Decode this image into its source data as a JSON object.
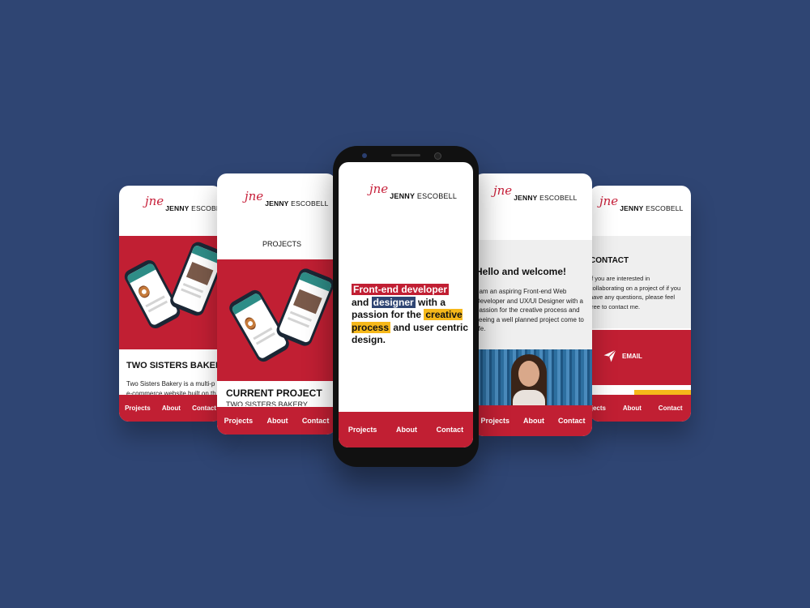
{
  "brand": {
    "signature": "jne",
    "first": "JENNY",
    "last": "ESCOBELL"
  },
  "nav": {
    "projects": "Projects",
    "about": "About",
    "contact": "Contact"
  },
  "card_far_left": {
    "title": "TWO SISTERS BAKERY",
    "body": "Two Sisters Bakery is a multi-p e-commerce website built on th"
  },
  "card_left": {
    "section_label": "PROJECTS",
    "title": "CURRENT PROJECT",
    "subtitle": "TWO SISTERS BAKERY"
  },
  "card_center": {
    "hero": {
      "part1": "Front-end developer",
      "part2": "and ",
      "part3": "designer",
      "part4": " with a passion for the ",
      "part5": "creative process",
      "part6": " and user centric design."
    }
  },
  "card_right": {
    "title": "Hello and welcome!",
    "body": "I am an aspiring Front-end Web Developer and UX/UI Designer with a passion for the creative process and seeing a well planned project come to life."
  },
  "card_far_right": {
    "title": "CONTACT",
    "body": "If you are interested in collaborating on a project of if you have any questions, please feel free to contact me.",
    "email_label": "EMAIL",
    "email_icon": "paper-plane-icon"
  },
  "colors": {
    "background": "#2f4573",
    "brand_red": "#c11f33",
    "accent_yellow": "#f6b81a",
    "accent_blue": "#2f4573"
  }
}
